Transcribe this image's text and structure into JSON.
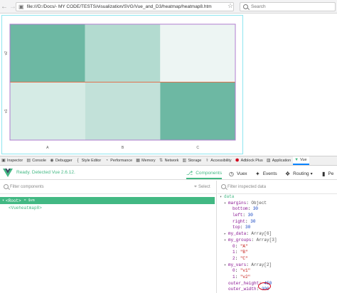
{
  "browser": {
    "back_icon": "arrow-left-icon",
    "forward_icon": "arrow-right-icon",
    "url": "file:///D:/Docs/- MY CODE/TESTS/visualization/SVG/Vue_and_D3/heatmap/heatmap8.htm",
    "search_placeholder": "Search"
  },
  "chart_data": {
    "type": "heatmap",
    "x_categories": [
      "A",
      "B",
      "C"
    ],
    "y_categories": [
      "v1",
      "v2"
    ],
    "cells": [
      {
        "x": "A",
        "y": "v2",
        "color": "#6db8a3"
      },
      {
        "x": "B",
        "y": "v2",
        "color": "#b3dbd0"
      },
      {
        "x": "C",
        "y": "v2",
        "color": "#edf5f3"
      },
      {
        "x": "A",
        "y": "v1",
        "color": "#d5ebe5"
      },
      {
        "x": "B",
        "y": "v1",
        "color": "#c2e1d9"
      },
      {
        "x": "C",
        "y": "v1",
        "color": "#6db8a3"
      }
    ],
    "separator_color": "#e0724e",
    "frame_color": "#b07ccf",
    "xlabel": "",
    "ylabel": ""
  },
  "devtools": {
    "tabs": [
      {
        "label": "Inspector",
        "icon": "inspector-icon"
      },
      {
        "label": "Console",
        "icon": "console-icon"
      },
      {
        "label": "Debugger",
        "icon": "debugger-icon"
      },
      {
        "label": "Style Editor",
        "icon": "style-editor-icon"
      },
      {
        "label": "Performance",
        "icon": "performance-icon"
      },
      {
        "label": "Memory",
        "icon": "memory-icon"
      },
      {
        "label": "Network",
        "icon": "network-icon"
      },
      {
        "label": "Storage",
        "icon": "storage-icon"
      },
      {
        "label": "Accessibility",
        "icon": "accessibility-icon"
      },
      {
        "label": "Adblock Plus",
        "icon": "adblock-icon"
      },
      {
        "label": "Application",
        "icon": "application-icon"
      },
      {
        "label": "Vue",
        "icon": "vue-icon"
      }
    ],
    "active_tab": "Vue"
  },
  "vue": {
    "ready_text": "Ready. Detected Vue 2.6.12.",
    "toolbar": {
      "components": "Components",
      "vuex": "Vuex",
      "events": "Events",
      "routing": "Routing",
      "perf": "Pe"
    },
    "components_filter_placeholder": "Filter components",
    "select_label": "Select",
    "tree": {
      "root": "<Root>",
      "root_suffix": "= $vm",
      "child": "<Vueheatmap8>"
    },
    "data_filter_placeholder": "Filter inspected data",
    "state": {
      "section": "data",
      "margins_key": "margins",
      "margins_type": "Object",
      "bottom_key": "bottom",
      "bottom_val": "30",
      "left_key": "left",
      "left_val": "30",
      "right_key": "right",
      "right_val": "30",
      "top_key": "top",
      "top_val": "30",
      "my_data_key": "my_data",
      "my_data_type": "Array[6]",
      "my_groups_key": "my_groups",
      "my_groups_type": "Array[3]",
      "g0_key": "0",
      "g0_val": "\"A\"",
      "g1_key": "1",
      "g1_val": "\"B\"",
      "g2_key": "2",
      "g2_val": "\"C\"",
      "my_vars_key": "my_vars",
      "my_vars_type": "Array[2]",
      "v0_key": "0",
      "v0_val": "\"v1\"",
      "v1_key": "1",
      "v1_val": "\"v2\"",
      "outer_height_key": "outer_height",
      "outer_height_val": "450",
      "outer_width_key": "outer_width",
      "outer_width_val": "300"
    }
  }
}
